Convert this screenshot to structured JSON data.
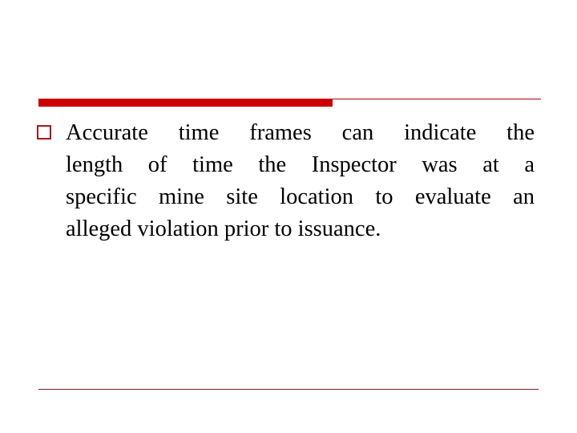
{
  "slide": {
    "bullet_icon": "hollow-square-bullet",
    "lines": [
      "Accurate time frames can indicate the",
      "length of time the Inspector was at a",
      "specific mine site location to evaluate an",
      "alleged violation prior to issuance."
    ]
  },
  "colors": {
    "accent": "#cc0000",
    "bullet": "#a51b1b",
    "footer_rule": "#7a1f1f"
  }
}
